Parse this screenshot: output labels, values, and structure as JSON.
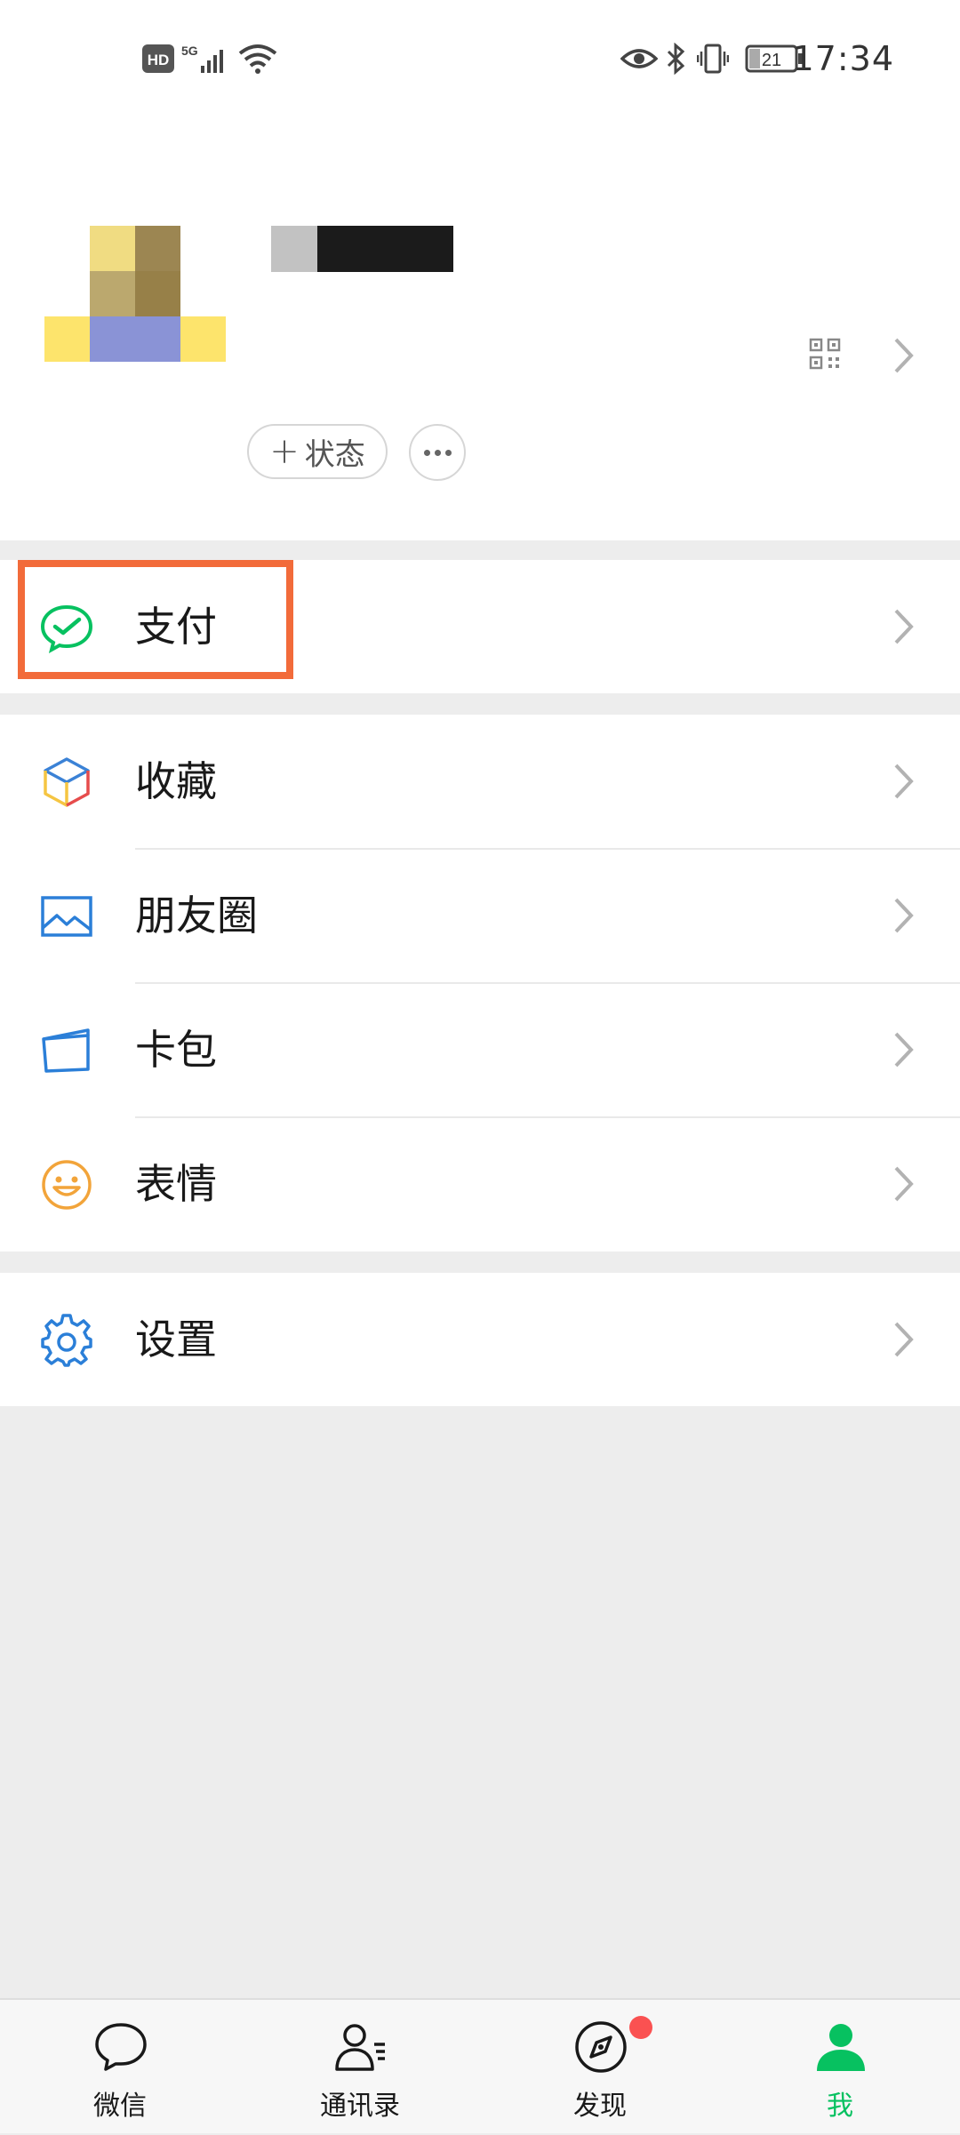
{
  "status_bar": {
    "hd_badge": "HD",
    "network": "5G",
    "battery": "21",
    "time": "17:34"
  },
  "profile": {
    "status_button": "状态",
    "status_plus": "+"
  },
  "menu": {
    "pay": "支付",
    "favorites": "收藏",
    "moments": "朋友圈",
    "cards": "卡包",
    "stickers": "表情",
    "settings": "设置"
  },
  "tabs": [
    {
      "label": "微信",
      "icon": "chat-bubble-icon"
    },
    {
      "label": "通讯录",
      "icon": "contacts-icon"
    },
    {
      "label": "发现",
      "icon": "compass-icon",
      "badge": true
    },
    {
      "label": "我",
      "icon": "person-icon",
      "active": true
    }
  ],
  "colors": {
    "accent": "#07c160",
    "highlight": "#f26b3a",
    "badge": "#fa5151"
  }
}
